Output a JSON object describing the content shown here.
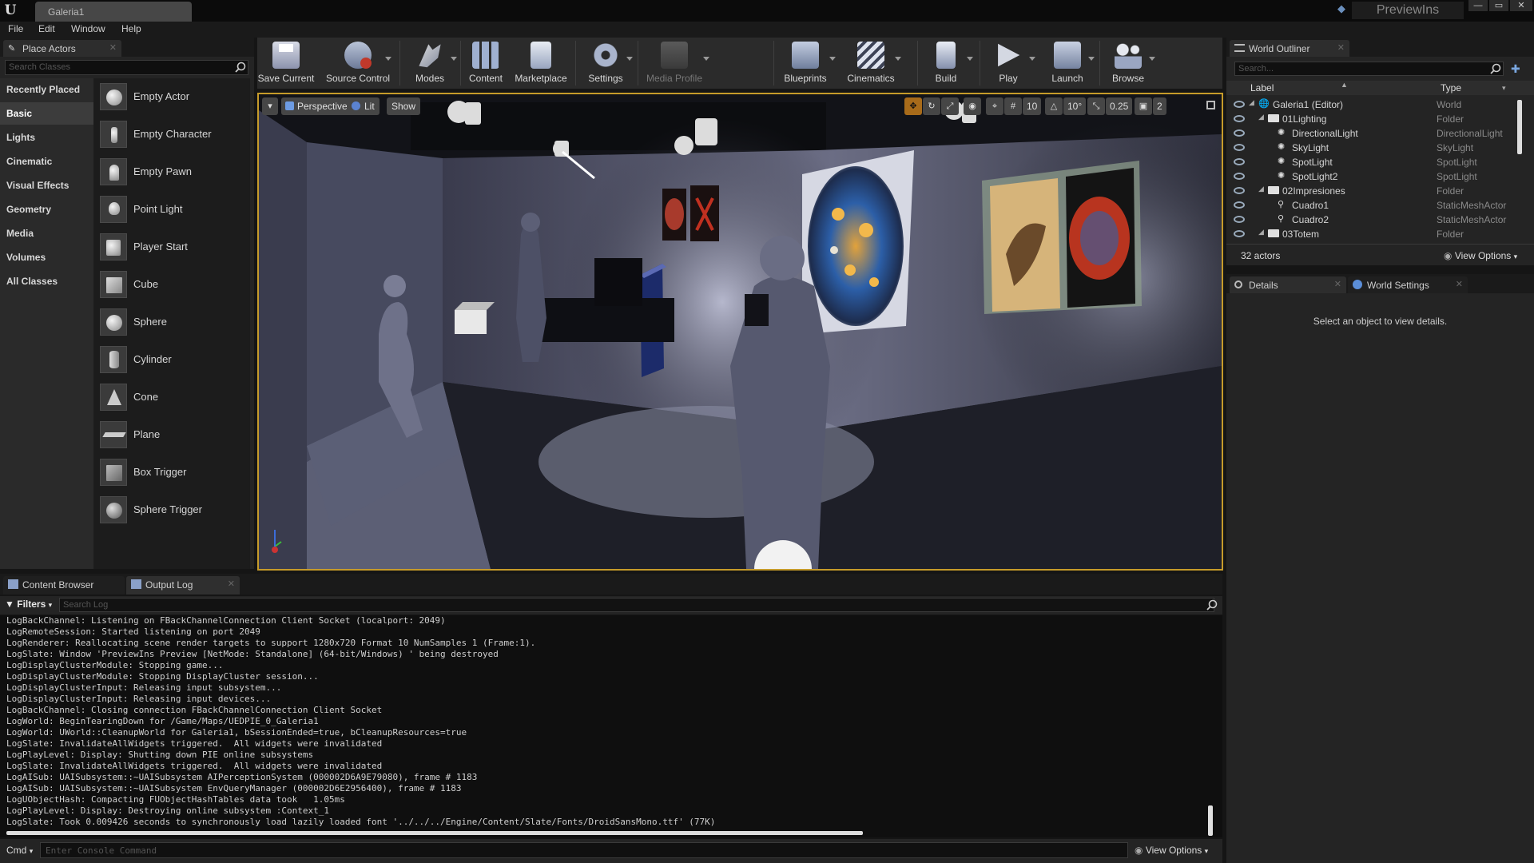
{
  "app": {
    "document_tab": "Galeria1",
    "project_name": "PreviewIns"
  },
  "menu": [
    "File",
    "Edit",
    "Window",
    "Help"
  ],
  "place_actors": {
    "tab_label": "Place Actors",
    "search_placeholder": "Search Classes",
    "categories": [
      "Recently Placed",
      "Basic",
      "Lights",
      "Cinematic",
      "Visual Effects",
      "Geometry",
      "Media",
      "Volumes",
      "All Classes"
    ],
    "active_category": "Basic",
    "items": [
      "Empty Actor",
      "Empty Character",
      "Empty Pawn",
      "Point Light",
      "Player Start",
      "Cube",
      "Sphere",
      "Cylinder",
      "Cone",
      "Plane",
      "Box Trigger",
      "Sphere Trigger"
    ]
  },
  "toolbar": {
    "buttons": [
      "Save Current",
      "Source Control",
      "Modes",
      "Content",
      "Marketplace",
      "Settings",
      "Media Profile",
      "Blueprints",
      "Cinematics",
      "Build",
      "Play",
      "Launch",
      "Browse"
    ]
  },
  "viewport": {
    "view_mode": "Perspective",
    "lighting_mode": "Lit",
    "show_label": "Show",
    "grid_snap": "10",
    "rotation_snap": "10°",
    "scale_snap": "0.25",
    "camera_speed": "2"
  },
  "bottom_tabs": {
    "content_browser": "Content Browser",
    "output_log": "Output Log",
    "filters": "Filters",
    "search_placeholder": "Search Log",
    "cmd_label": "Cmd",
    "cmd_placeholder": "Enter Console Command",
    "view_options": "View Options"
  },
  "log_lines": [
    "LogBackChannel: Listening on FBackChannelConnection Client Socket (localport: 2049)",
    "LogRemoteSession: Started listening on port 2049",
    "LogRenderer: Reallocating scene render targets to support 1280x720 Format 10 NumSamples 1 (Frame:1).",
    "LogSlate: Window 'PreviewIns Preview [NetMode: Standalone] (64-bit/Windows) ' being destroyed",
    "LogDisplayClusterModule: Stopping game...",
    "LogDisplayClusterModule: Stopping DisplayCluster session...",
    "LogDisplayClusterInput: Releasing input subsystem...",
    "LogDisplayClusterInput: Releasing input devices...",
    "LogBackChannel: Closing connection FBackChannelConnection Client Socket",
    "LogWorld: BeginTearingDown for /Game/Maps/UEDPIE_0_Galeria1",
    "LogWorld: UWorld::CleanupWorld for Galeria1, bSessionEnded=true, bCleanupResources=true",
    "LogSlate: InvalidateAllWidgets triggered.  All widgets were invalidated",
    "LogPlayLevel: Display: Shutting down PIE online subsystems",
    "LogSlate: InvalidateAllWidgets triggered.  All widgets were invalidated",
    "LogAISub: UAISubsystem::~UAISubsystem AIPerceptionSystem (000002D6A9E79080), frame # 1183",
    "LogAISub: UAISubsystem::~UAISubsystem EnvQueryManager (000002D6E2956400), frame # 1183",
    "LogUObjectHash: Compacting FUObjectHashTables data took   1.05ms",
    "LogPlayLevel: Display: Destroying online subsystem :Context_1",
    "LogSlate: Took 0.009426 seconds to synchronously load lazily loaded font '../../../Engine/Content/Slate/Fonts/DroidSansMono.ttf' (77K)"
  ],
  "outliner": {
    "tab_label": "World Outliner",
    "search_placeholder": "Search...",
    "col_label": "Label",
    "col_type": "Type",
    "rows": [
      {
        "label": "Galeria1 (Editor)",
        "type": "World"
      },
      {
        "label": "01Lighting",
        "type": "Folder"
      },
      {
        "label": "DirectionalLight",
        "type": "DirectionalLight"
      },
      {
        "label": "SkyLight",
        "type": "SkyLight"
      },
      {
        "label": "SpotLight",
        "type": "SpotLight"
      },
      {
        "label": "SpotLight2",
        "type": "SpotLight"
      },
      {
        "label": "02Impresiones",
        "type": "Folder"
      },
      {
        "label": "Cuadro1",
        "type": "StaticMeshActor"
      },
      {
        "label": "Cuadro2",
        "type": "StaticMeshActor"
      },
      {
        "label": "03Totem",
        "type": "Folder"
      }
    ],
    "actor_count": "32 actors",
    "view_options": "View Options"
  },
  "details": {
    "tab_label": "Details",
    "world_settings_tab": "World Settings",
    "empty_message": "Select an object to view details."
  },
  "colors": {
    "viewport_border": "#c69b2a",
    "accent_blue": "#4a7fc0"
  }
}
